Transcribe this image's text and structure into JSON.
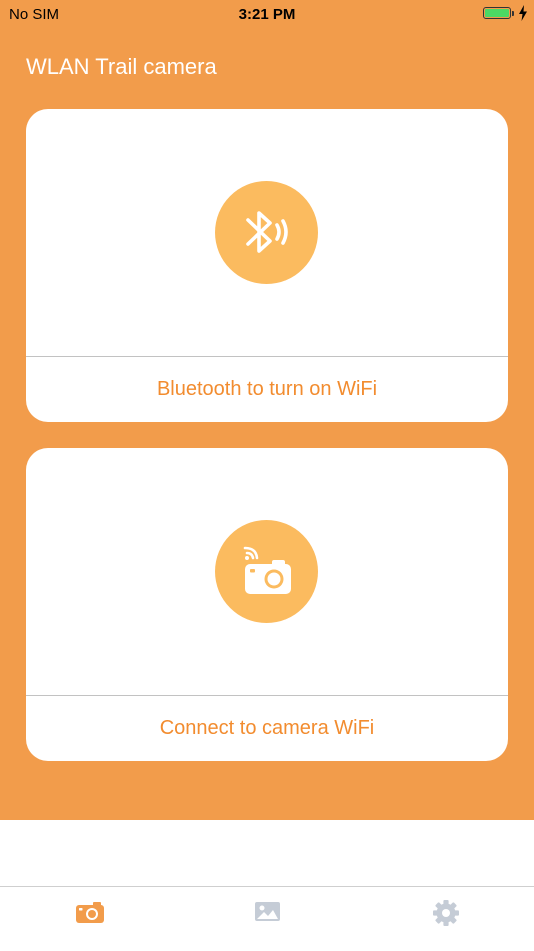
{
  "status_bar": {
    "carrier": "No SIM",
    "time": "3:21 PM",
    "battery_level": 1.0
  },
  "header": {
    "title": "WLAN Trail camera"
  },
  "cards": [
    {
      "label": "Bluetooth to turn on WiFi",
      "icon": "bluetooth-signal-icon"
    },
    {
      "label": "Connect to camera WiFi",
      "icon": "wifi-camera-icon"
    }
  ],
  "tab_bar": {
    "items": [
      {
        "icon": "camera-icon",
        "selected": true
      },
      {
        "icon": "gallery-icon",
        "selected": false
      },
      {
        "icon": "gear-icon",
        "selected": false
      }
    ]
  },
  "colors": {
    "accent": "#f29c4b",
    "icon_circle": "#fbbb5f",
    "label_text": "#f28c2f",
    "tab_selected": "#f29c4b",
    "tab_unselected": "#c5ccd6",
    "battery": "#4cd964"
  }
}
